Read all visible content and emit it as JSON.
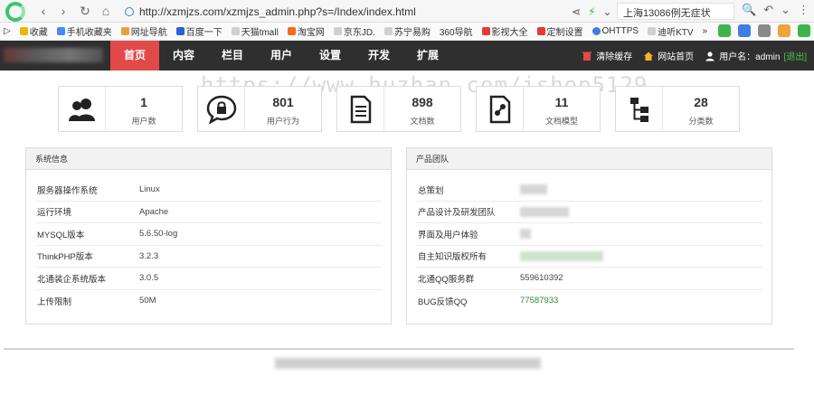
{
  "browser": {
    "url": "http://xzmjzs.com/xzmjzs_admin.php?s=/Index/index.html",
    "news": "上海13086例无症状"
  },
  "bookmarks": [
    {
      "label": "收藏",
      "color": "#f2b400"
    },
    {
      "label": "手机收藏夹",
      "color": "#4a8af4"
    },
    {
      "label": "网址导航",
      "color": "#e6a23c"
    },
    {
      "label": "百度一下",
      "color": "#2a63d4"
    },
    {
      "label": "天猫tmall",
      "color": "#d0d0d0"
    },
    {
      "label": "淘宝网",
      "color": "#f66b1a"
    },
    {
      "label": "京东JD.",
      "color": "#d0d0d0"
    },
    {
      "label": "苏宁易购",
      "color": "#d0d0d0"
    },
    {
      "label": "360导航",
      "color": "#ffffff"
    },
    {
      "label": "影视大全",
      "color": "#e53935"
    },
    {
      "label": "定制设置",
      "color": "#e53935"
    },
    {
      "label": "OHTTPS",
      "color": "#3f7de0"
    },
    {
      "label": "迪听KTV",
      "color": "#d0d0d0"
    }
  ],
  "nav": {
    "items": [
      "首页",
      "内容",
      "栏目",
      "用户",
      "设置",
      "开发",
      "扩展"
    ],
    "active_index": 0
  },
  "header_right": {
    "clear_cache": "清除缓存",
    "site_home": "网站首页",
    "user_label": "用户名：admin",
    "exit": "[退出]"
  },
  "watermark": "https://www.huzhan.com/ishop5129",
  "stats": [
    {
      "value": "1",
      "label": "用户数",
      "icon": "users-icon"
    },
    {
      "value": "801",
      "label": "用户行为",
      "icon": "lock-chat-icon"
    },
    {
      "value": "898",
      "label": "文档数",
      "icon": "document-icon"
    },
    {
      "value": "11",
      "label": "文档模型",
      "icon": "model-icon"
    },
    {
      "value": "28",
      "label": "分类数",
      "icon": "tree-icon"
    }
  ],
  "system_info": {
    "title": "系统信息",
    "rows": [
      {
        "key": "服务器操作系统",
        "value": "Linux"
      },
      {
        "key": "运行环境",
        "value": "Apache"
      },
      {
        "key": "MYSQL版本",
        "value": "5.6.50-log"
      },
      {
        "key": "ThinkPHP版本",
        "value": "3.2.3"
      },
      {
        "key": "北通装企系统版本",
        "value": "3.0.5"
      },
      {
        "key": "上传限制",
        "value": "50M"
      }
    ]
  },
  "product_team": {
    "title": "产品团队",
    "rows": [
      {
        "key": "总策划",
        "value": ""
      },
      {
        "key": "产品设计及研发团队",
        "value": ""
      },
      {
        "key": "界面及用户体验",
        "value": ""
      },
      {
        "key": "自主知识版权所有",
        "value": ""
      },
      {
        "key": "北通QQ服务群",
        "value": "559610392"
      },
      {
        "key": "BUG反馈QQ",
        "value": "77587933"
      }
    ]
  }
}
